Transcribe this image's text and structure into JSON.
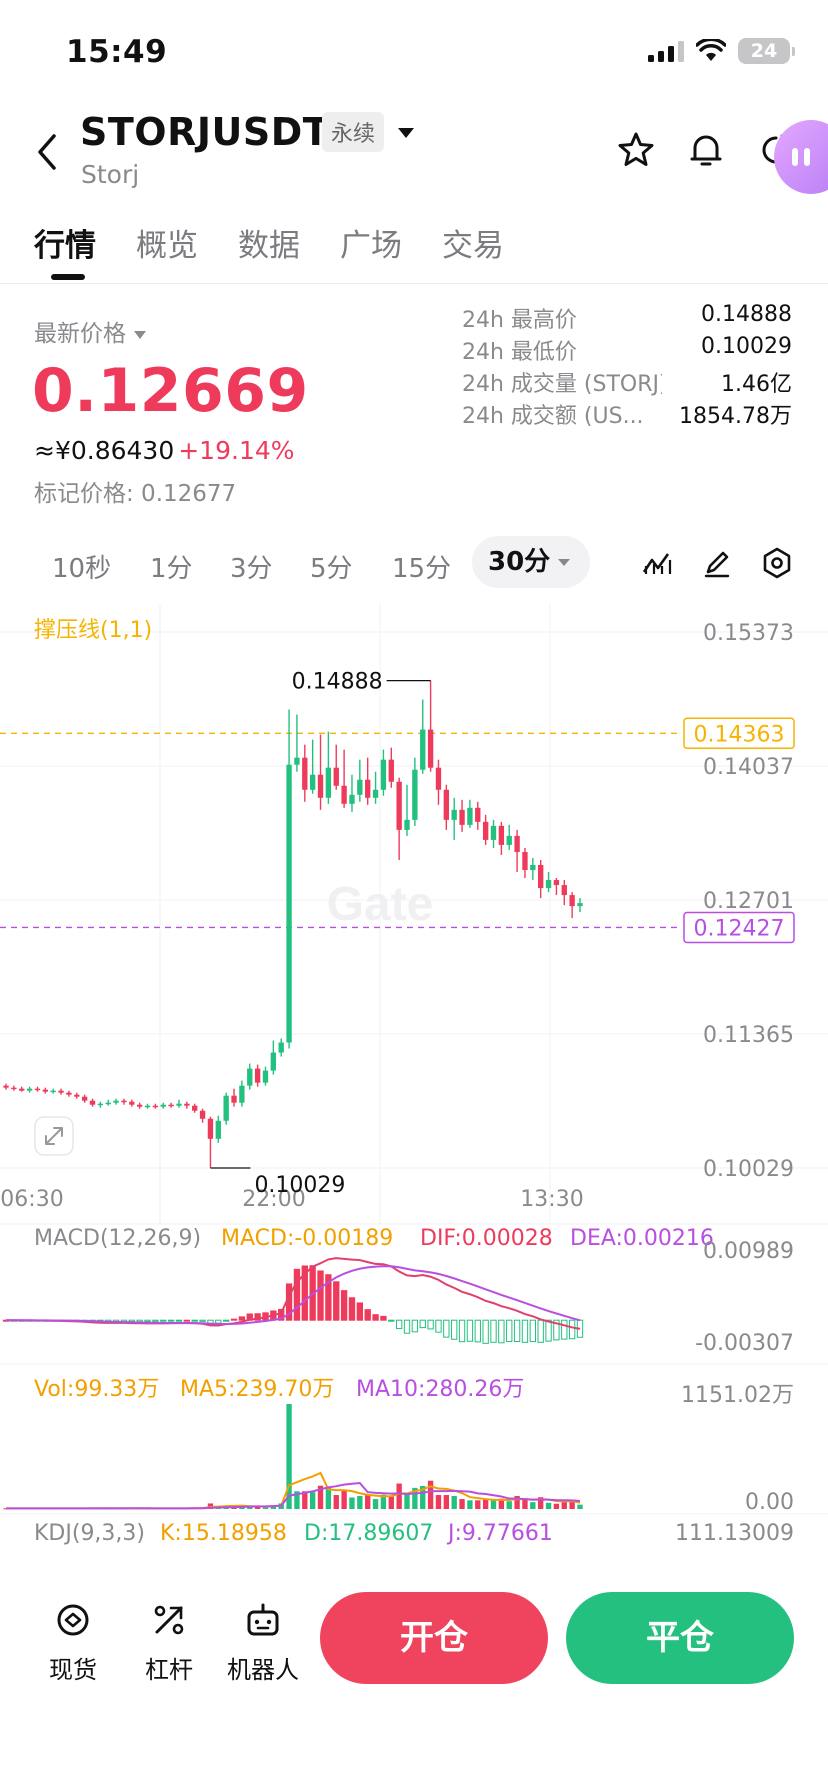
{
  "status_bar": {
    "time": "15:49",
    "battery": "24"
  },
  "header": {
    "pair": "STORJUSDT",
    "contract_type": "永续",
    "name": "Storj"
  },
  "tabs": [
    "行情",
    "概览",
    "数据",
    "广场",
    "交易"
  ],
  "price": {
    "latest_label": "最新价格",
    "last": "0.12669",
    "cny": "≈¥0.86430",
    "change_pct": "+19.14%",
    "mark_label": "标记价格: 0.12677"
  },
  "stats": [
    {
      "label": "24h 最高价",
      "value": "0.14888"
    },
    {
      "label": "24h 最低价",
      "value": "0.10029"
    },
    {
      "label": "24h 成交量 (STORJ)",
      "value": "1.46亿"
    },
    {
      "label": "24h 成交额 (US...",
      "value": "1854.78万"
    }
  ],
  "timeframes": [
    "10秒",
    "1分",
    "3分",
    "5分",
    "15分",
    "30分"
  ],
  "active_timeframe": "30分",
  "colors": {
    "up": "#23c07f",
    "down": "#ef3b5b",
    "accent": "#f5b400",
    "purple": "#b84fe0"
  },
  "chart_data": {
    "type": "candlestick",
    "indicator_label": "撑压线(1,1)",
    "y_axis_labels": [
      "0.15373",
      "0.14037",
      "0.12701",
      "0.11365",
      "0.10029"
    ],
    "y_range": [
      0.10029,
      0.15373
    ],
    "x_axis_labels": [
      "06:30",
      "22:00",
      "13:30"
    ],
    "resistance_line": {
      "value": 0.14363,
      "label": "0.14363"
    },
    "support_line": {
      "value": 0.12427,
      "label": "0.12427"
    },
    "high_marker": {
      "value": 0.14888,
      "label": "0.14888"
    },
    "low_marker": {
      "value": 0.10029,
      "label": "0.10029"
    },
    "watermark": "Gate",
    "candles": [
      [
        0.1085,
        0.1083,
        0.1087,
        0.1081
      ],
      [
        0.1083,
        0.1082,
        0.1085,
        0.108
      ],
      [
        0.1082,
        0.108,
        0.1084,
        0.1079
      ],
      [
        0.108,
        0.1082,
        0.1084,
        0.1078
      ],
      [
        0.1082,
        0.1081,
        0.1084,
        0.1079
      ],
      [
        0.1081,
        0.1079,
        0.1083,
        0.1077
      ],
      [
        0.1079,
        0.108,
        0.1082,
        0.1077
      ],
      [
        0.108,
        0.1078,
        0.1082,
        0.1076
      ],
      [
        0.1078,
        0.1076,
        0.108,
        0.1074
      ],
      [
        0.1076,
        0.1074,
        0.1078,
        0.1072
      ],
      [
        0.1074,
        0.107,
        0.1076,
        0.1068
      ],
      [
        0.107,
        0.1066,
        0.1072,
        0.1064
      ],
      [
        0.1066,
        0.1067,
        0.1069,
        0.1063
      ],
      [
        0.1067,
        0.1068,
        0.1071,
        0.1065
      ],
      [
        0.1068,
        0.107,
        0.1072,
        0.1066
      ],
      [
        0.107,
        0.1069,
        0.1072,
        0.1066
      ],
      [
        0.1069,
        0.1066,
        0.1071,
        0.1064
      ],
      [
        0.1066,
        0.1064,
        0.1068,
        0.1062
      ],
      [
        0.1064,
        0.1065,
        0.1067,
        0.1062
      ],
      [
        0.1065,
        0.1064,
        0.1067,
        0.1062
      ],
      [
        0.1064,
        0.1066,
        0.1068,
        0.1062
      ],
      [
        0.1066,
        0.1065,
        0.1068,
        0.1063
      ],
      [
        0.1065,
        0.1067,
        0.1071,
        0.1063
      ],
      [
        0.1067,
        0.1065,
        0.1069,
        0.1062
      ],
      [
        0.1065,
        0.106,
        0.1067,
        0.1058
      ],
      [
        0.106,
        0.1052,
        0.1062,
        0.1048
      ],
      [
        0.1052,
        0.1032,
        0.1054,
        0.1003
      ],
      [
        0.1032,
        0.105,
        0.1055,
        0.1028
      ],
      [
        0.105,
        0.1075,
        0.1078,
        0.1046
      ],
      [
        0.1075,
        0.1068,
        0.1082,
        0.1064
      ],
      [
        0.1068,
        0.1085,
        0.109,
        0.1064
      ],
      [
        0.1085,
        0.1102,
        0.1107,
        0.1081
      ],
      [
        0.1102,
        0.1088,
        0.1106,
        0.1084
      ],
      [
        0.1088,
        0.11,
        0.1104,
        0.1085
      ],
      [
        0.11,
        0.1118,
        0.113,
        0.1096
      ],
      [
        0.1118,
        0.1128,
        0.1132,
        0.1114
      ],
      [
        0.1128,
        0.1405,
        0.146,
        0.1122
      ],
      [
        0.1405,
        0.1412,
        0.1455,
        0.1398
      ],
      [
        0.1412,
        0.138,
        0.1425,
        0.1368
      ],
      [
        0.138,
        0.1395,
        0.143,
        0.1376
      ],
      [
        0.1395,
        0.1372,
        0.1435,
        0.136
      ],
      [
        0.1372,
        0.1402,
        0.1438,
        0.1366
      ],
      [
        0.1402,
        0.1384,
        0.1425,
        0.138
      ],
      [
        0.1384,
        0.1366,
        0.142,
        0.1362
      ],
      [
        0.1366,
        0.1375,
        0.1395,
        0.1358
      ],
      [
        0.1375,
        0.139,
        0.141,
        0.1368
      ],
      [
        0.139,
        0.1372,
        0.1412,
        0.1365
      ],
      [
        0.1372,
        0.138,
        0.1398,
        0.1366
      ],
      [
        0.138,
        0.141,
        0.142,
        0.1374
      ],
      [
        0.141,
        0.1388,
        0.1422,
        0.1382
      ],
      [
        0.1388,
        0.134,
        0.1392,
        0.131
      ],
      [
        0.134,
        0.135,
        0.1385,
        0.1334
      ],
      [
        0.135,
        0.14,
        0.1412,
        0.1344
      ],
      [
        0.14,
        0.144,
        0.147,
        0.1396
      ],
      [
        0.144,
        0.1402,
        0.1489,
        0.1398
      ],
      [
        0.1402,
        0.138,
        0.141,
        0.1365
      ],
      [
        0.138,
        0.135,
        0.1385,
        0.134
      ],
      [
        0.135,
        0.136,
        0.1372,
        0.133
      ],
      [
        0.136,
        0.1345,
        0.137,
        0.1338
      ],
      [
        0.1345,
        0.1362,
        0.137,
        0.1342
      ],
      [
        0.1362,
        0.1348,
        0.1368,
        0.134
      ],
      [
        0.1348,
        0.133,
        0.1355,
        0.1325
      ],
      [
        0.133,
        0.1344,
        0.135,
        0.1322
      ],
      [
        0.1344,
        0.1325,
        0.1348,
        0.1315
      ],
      [
        0.1325,
        0.1334,
        0.1345,
        0.132
      ],
      [
        0.1334,
        0.1318,
        0.134,
        0.1298
      ],
      [
        0.1318,
        0.13,
        0.1322,
        0.1292
      ],
      [
        0.13,
        0.1305,
        0.1312,
        0.129
      ],
      [
        0.1305,
        0.1282,
        0.131,
        0.1272
      ],
      [
        0.1282,
        0.129,
        0.1298,
        0.1278
      ],
      [
        0.129,
        0.1285,
        0.1292,
        0.1275
      ],
      [
        0.1285,
        0.1275,
        0.129,
        0.1265
      ],
      [
        0.1275,
        0.1264,
        0.1278,
        0.1252
      ],
      [
        0.1264,
        0.1267,
        0.1272,
        0.1258
      ]
    ],
    "macd": {
      "label": "MACD(12,26,9)",
      "macd_text": "MACD:-0.00189",
      "dif_text": "DIF:0.00028",
      "dea_text": "DEA:0.00216",
      "y_axis_labels": [
        "0.00989",
        "-0.00307"
      ],
      "y_range": [
        -0.00307,
        0.00989
      ]
    },
    "volume": {
      "vol_text": "Vol:99.33万",
      "ma5_text": "MA5:239.70万",
      "ma10_text": "MA10:280.26万",
      "y_axis_labels": [
        "1151.02万",
        "0.00"
      ],
      "y_max": 1151.02
    },
    "kdj": {
      "label": "KDJ(9,3,3)",
      "k_text": "K:15.18958",
      "d_text": "D:17.89607",
      "j_text": "J:9.77661",
      "y_axis_label": "111.13009"
    }
  },
  "bottom_nav": {
    "spot": "现货",
    "leverage": "杠杆",
    "robot": "机器人",
    "open": "开仓",
    "close": "平仓"
  }
}
